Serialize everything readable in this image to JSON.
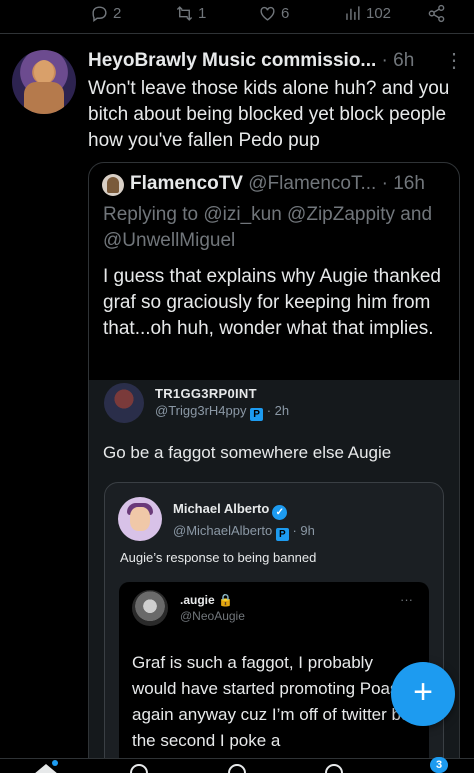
{
  "actions": {
    "replies": "2",
    "reposts": "1",
    "likes": "6",
    "views": "102"
  },
  "main_tweet": {
    "name": "HeyoBrawly Music commissio...",
    "time": "· 6h",
    "more": "⋮",
    "text": "Won't leave those kids alone huh? and you bitch about being blocked yet block people how you've fallen Pedo pup"
  },
  "quoted": {
    "name": "FlamencoTV",
    "handle": "@FlamencoT...",
    "time": "· 16h",
    "replying": "Replying to @izi_kun @ZipZappity and @UnwellMiguel",
    "text": "I guess that explains why Augie thanked graf so graciously for keeping him from that...oh huh, wonder what that implies."
  },
  "screenshot": {
    "name": "TR1GG3RP0INT",
    "handle": "@Trigg3rH4ppy",
    "badge": "P",
    "time": "· 2h",
    "text": "Go be a faggot somewhere else Augie",
    "inner": {
      "name": "Michael Alberto",
      "handle": "@MichaelAlberto",
      "badge": "P",
      "time": "· 9h",
      "text": "Augie’s response to being banned",
      "innermost": {
        "name": ".augie",
        "lock": "🔒",
        "handle": "@NeoAugie",
        "more": "···",
        "text": "Graf is such a faggot, I probably would have started promoting Poast again anyway cuz I’m off of twitter but the second I poke a"
      }
    }
  },
  "compose": {
    "label": "+"
  },
  "nav": {
    "notifications_badge": "3"
  },
  "colors": {
    "accent": "#1d9bf0",
    "muted": "#71767b",
    "text": "#e7e9ea",
    "background": "#000000"
  }
}
